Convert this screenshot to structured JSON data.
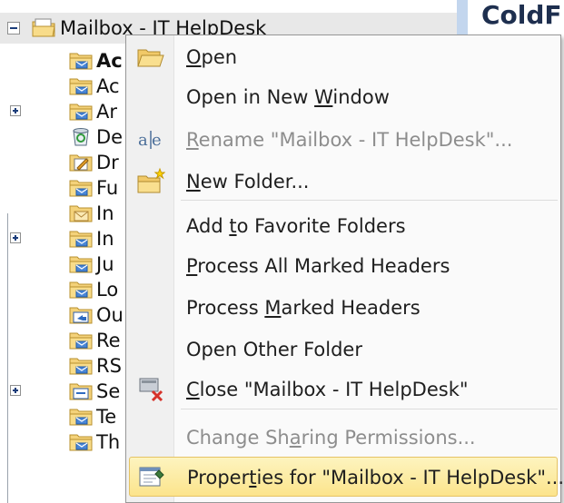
{
  "folder_pane": {
    "root_label": "Mailbox - IT HelpDesk",
    "right_header_fragment": "ColdF",
    "rows": [
      {
        "label": "Ac",
        "bold": true,
        "expander": false,
        "icon": "mail-folder-icon"
      },
      {
        "label": "Ac",
        "bold": false,
        "expander": false,
        "icon": "mail-folder-icon"
      },
      {
        "label": "Ar",
        "bold": false,
        "expander": true,
        "icon": "mail-folder-icon"
      },
      {
        "label": "De",
        "bold": false,
        "expander": false,
        "icon": "deleted-items-icon"
      },
      {
        "label": "Dr",
        "bold": false,
        "expander": false,
        "icon": "drafts-icon"
      },
      {
        "label": "Fu",
        "bold": false,
        "expander": false,
        "icon": "mail-folder-icon"
      },
      {
        "label": "In",
        "bold": false,
        "expander": false,
        "icon": "inbox-icon"
      },
      {
        "label": "In",
        "bold": false,
        "expander": true,
        "icon": "mail-folder-icon"
      },
      {
        "label": "Ju",
        "bold": false,
        "expander": false,
        "icon": "mail-folder-icon"
      },
      {
        "label": "Lo",
        "bold": false,
        "expander": false,
        "icon": "mail-folder-icon"
      },
      {
        "label": "Ou",
        "bold": false,
        "expander": false,
        "icon": "outbox-icon"
      },
      {
        "label": "Re",
        "bold": false,
        "expander": false,
        "icon": "mail-folder-icon"
      },
      {
        "label": "RS",
        "bold": false,
        "expander": false,
        "icon": "mail-folder-icon"
      },
      {
        "label": "Se",
        "bold": false,
        "expander": true,
        "icon": "sent-items-icon"
      },
      {
        "label": "Te",
        "bold": false,
        "expander": false,
        "icon": "mail-folder-icon"
      },
      {
        "label": "Th",
        "bold": false,
        "expander": false,
        "icon": "mail-folder-icon"
      }
    ]
  },
  "context_menu": {
    "items": [
      {
        "pre": "",
        "u": "O",
        "post": "pen",
        "icon": "open-folder-icon",
        "disabled": false
      },
      {
        "pre": "Open in New ",
        "u": "W",
        "post": "indow",
        "icon": "",
        "disabled": false
      },
      {
        "pre": "",
        "u": "R",
        "post": "ename \"Mailbox - IT HelpDesk\"...",
        "icon": "rename-icon",
        "disabled": true
      },
      {
        "pre": "",
        "u": "N",
        "post": "ew Folder...",
        "icon": "new-folder-icon",
        "disabled": false
      },
      {
        "pre": "Add ",
        "u": "t",
        "post": "o Favorite Folders",
        "icon": "",
        "disabled": false
      },
      {
        "pre": "",
        "u": "P",
        "post": "rocess All Marked Headers",
        "icon": "",
        "disabled": false
      },
      {
        "pre": "Process ",
        "u": "M",
        "post": "arked Headers",
        "icon": "",
        "disabled": false
      },
      {
        "pre": "Open Other Folder",
        "u": "",
        "post": "",
        "icon": "",
        "disabled": false
      },
      {
        "pre": "",
        "u": "C",
        "post": "lose \"Mailbox - IT HelpDesk\"",
        "icon": "close-mailbox-icon",
        "disabled": false
      },
      {
        "pre": "Change Sh",
        "u": "a",
        "post": "ring Permissions...",
        "icon": "",
        "disabled": true
      },
      {
        "pre": "Proper",
        "u": "t",
        "post": "ies for \"Mailbox - IT HelpDesk\"...",
        "icon": "properties-icon",
        "disabled": false,
        "highlighted": true
      }
    ],
    "highlight_color": "#fce48c"
  }
}
